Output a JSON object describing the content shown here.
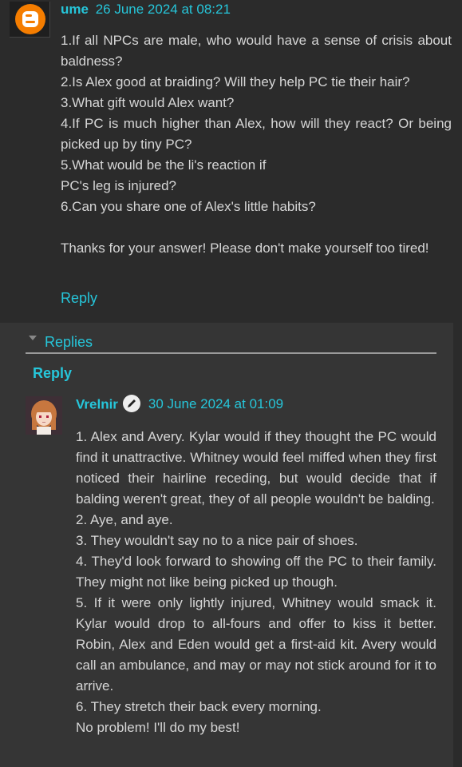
{
  "comment": {
    "author": "ume",
    "date": "26 June 2024 at 08:21",
    "lines": [
      "1.If all NPCs are male, who would have a sense of crisis about baldness?",
      "2.Is Alex good at braiding? Will they help PC tie their hair?",
      "3.What gift would Alex want?",
      "4.If PC is much higher than Alex, how will they react? Or being picked up by tiny PC?",
      "5.What would be the li's reaction if",
      "PC's leg is injured?",
      "6.Can you share one of Alex's little habits?",
      "",
      "Thanks for your answer! Please don't make yourself too tired!"
    ],
    "reply_label": "Reply",
    "avatar_icon": "blogger-logo-icon"
  },
  "replies": {
    "toggle_label": "Replies",
    "reply_label": "Reply",
    "reply": {
      "author": "Vrelnir",
      "date": "30 June 2024 at 01:09",
      "lines": [
        "1. Alex and Avery. Kylar would if they thought the PC would find it unattractive. Whitney would feel miffed when they first noticed their hairline receding, but would decide that if balding weren't great, they of all people wouldn't be balding.",
        "2. Aye, and aye.",
        "3. They wouldn't say no to a nice pair of shoes.",
        "4. They'd look forward to showing off the PC to their family. They might not like being picked up though.",
        "5. If it were only lightly injured, Whitney would smack it. Kylar would drop to all-fours and offer to kiss it better. Robin, Alex and Eden would get a first-aid kit. Avery would call an ambulance, and may or may not stick around for it to arrive.",
        "6. They stretch their back every morning.",
        "No problem! I'll do my best!"
      ]
    }
  },
  "colors": {
    "accent": "#26c6da",
    "background": "#2b2b2b",
    "reply_box": "#353535",
    "text": "#d6d6d6",
    "blogger_orange": "#f57d00"
  }
}
